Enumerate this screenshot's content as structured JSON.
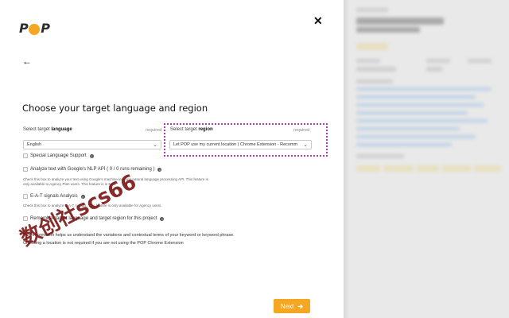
{
  "header": {
    "logo_text_1": "P",
    "logo_text_2": "P",
    "close_icon": "close-icon",
    "back_icon": "arrow-left-icon"
  },
  "title": "Choose your target language and region",
  "language": {
    "label_prefix": "Select target ",
    "label_bold": "language",
    "required": "required",
    "value": "English"
  },
  "region": {
    "label_prefix": "Select target ",
    "label_bold": "region",
    "required": "required",
    "value": "Let POP use my current location ( Chrome Extension - Recomm"
  },
  "options": [
    {
      "label": "Special Language Support",
      "help": ""
    },
    {
      "label": "Analyze text with Google's NLP API ( 0 / 0 runs remaining )",
      "help": "Check this box to analyze your text using Google's machine learning natural language processing API. This feature is only available to Agency Plan users. This feature is in beta."
    },
    {
      "label": "E-A-T signals Analysis",
      "help": "Check this box to analyze E-A-T signals. This feature is only available for Agency users."
    },
    {
      "label": "Remember target language and target region for this project",
      "help": ""
    }
  ],
  "note_line_1": "This information helps us understand the variations and contextual terms of your keyword or keyword phrase.",
  "note_line_2": "Choosing a location is not required if you are not using the POP Chrome Extension",
  "next_label": "Next",
  "watermark": "数创社scs66",
  "colors": {
    "accent": "#f5a623",
    "highlight": "#b03aa8"
  }
}
